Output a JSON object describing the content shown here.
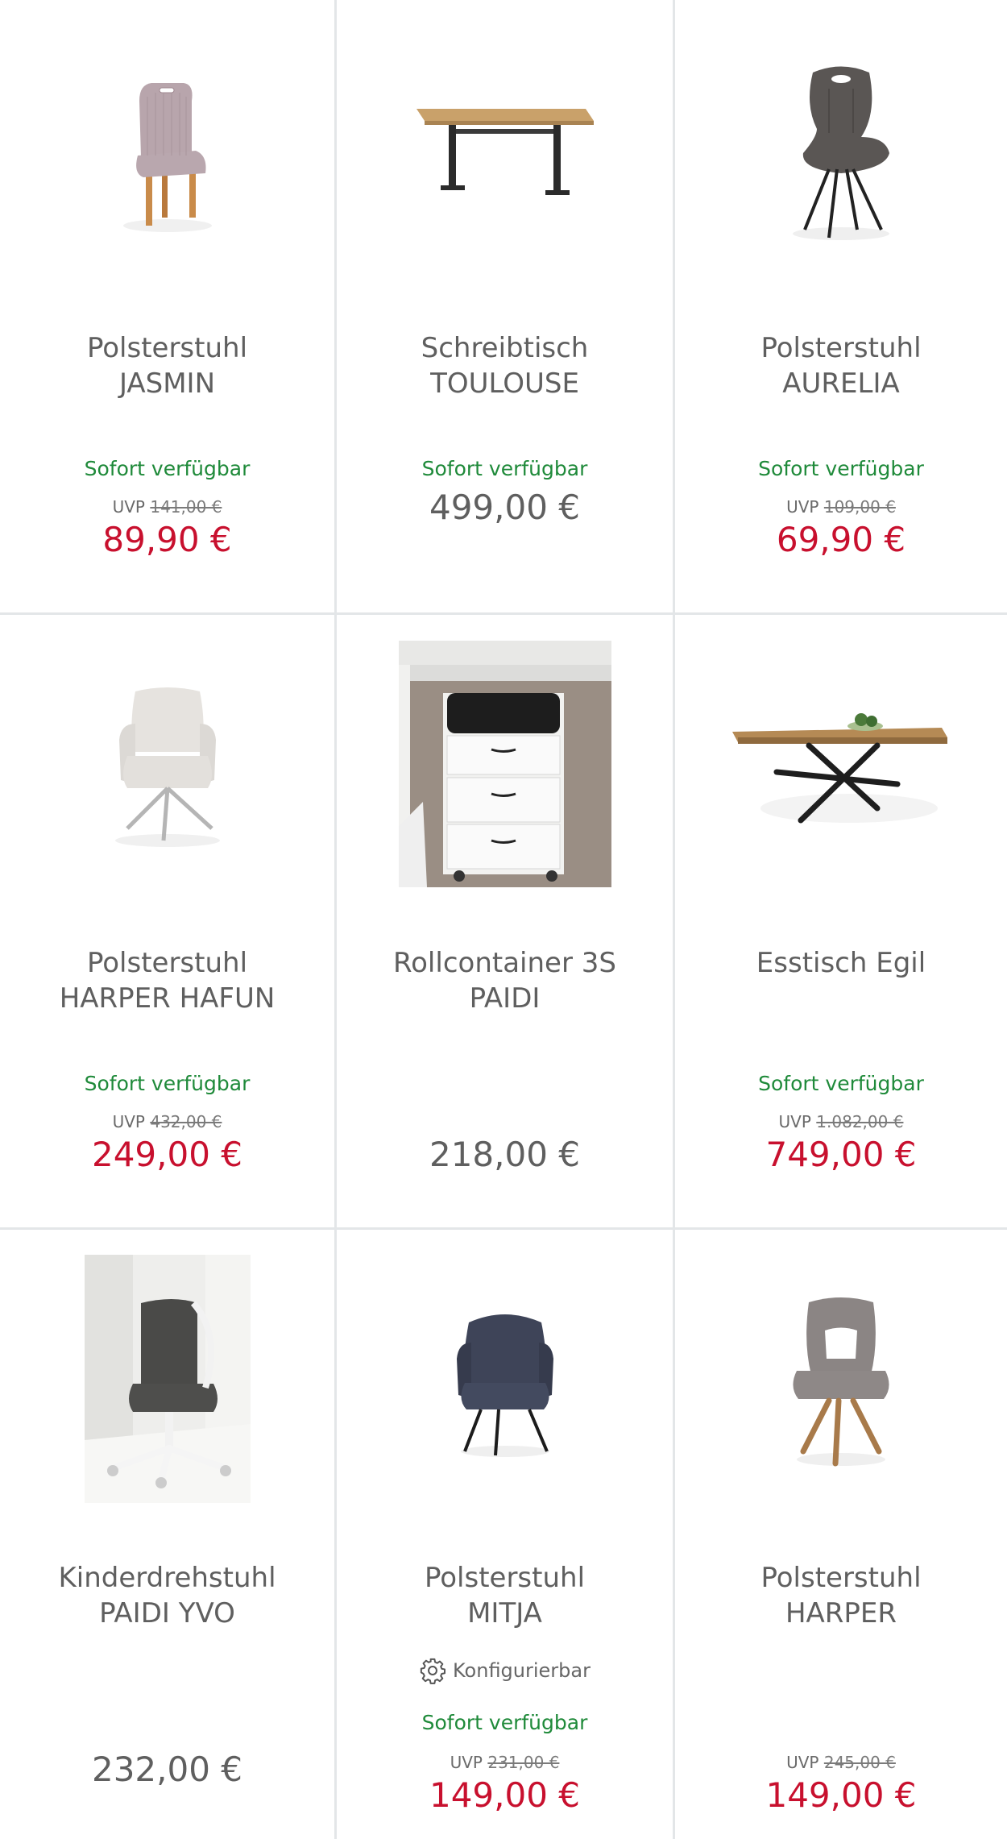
{
  "products": [
    {
      "name1": "Polsterstuhl",
      "name2": "JASMIN",
      "availability": "Sofort verfügbar",
      "uvp_label": "UVP",
      "uvp_price": "141,00 €",
      "price": "89,90 €"
    },
    {
      "name1": "Schreibtisch",
      "name2": "TOULOUSE",
      "availability": "Sofort verfügbar",
      "price": "499,00 €"
    },
    {
      "name1": "Polsterstuhl",
      "name2": "AURELIA",
      "availability": "Sofort verfügbar",
      "uvp_label": "UVP",
      "uvp_price": "109,00 €",
      "price": "69,90 €"
    },
    {
      "name1": "Polsterstuhl",
      "name2": "HARPER HAFUN",
      "availability": "Sofort verfügbar",
      "uvp_label": "UVP",
      "uvp_price": "432,00 €",
      "price": "249,00 €"
    },
    {
      "name1": "Rollcontainer 3S",
      "name2": "PAIDI",
      "price": "218,00 €"
    },
    {
      "name1": "Esstisch Egil",
      "availability": "Sofort verfügbar",
      "uvp_label": "UVP",
      "uvp_price": "1.082,00 €",
      "price": "749,00 €"
    },
    {
      "name1": "Kinderdrehstuhl",
      "name2": "PAIDI YVO",
      "price": "232,00 €"
    },
    {
      "name1": "Polsterstuhl",
      "name2": "MITJA",
      "config": "Konfigurierbar",
      "availability": "Sofort verfügbar",
      "uvp_label": "UVP",
      "uvp_price": "231,00 €",
      "price": "149,00 €"
    },
    {
      "name1": "Polsterstuhl",
      "name2": "HARPER",
      "uvp_label": "UVP",
      "uvp_price": "245,00 €",
      "price": "149,00 €"
    }
  ],
  "colors": {
    "sale_price": "#c8102e",
    "available": "#1f8a3a",
    "divider": "#e3e6e8"
  }
}
